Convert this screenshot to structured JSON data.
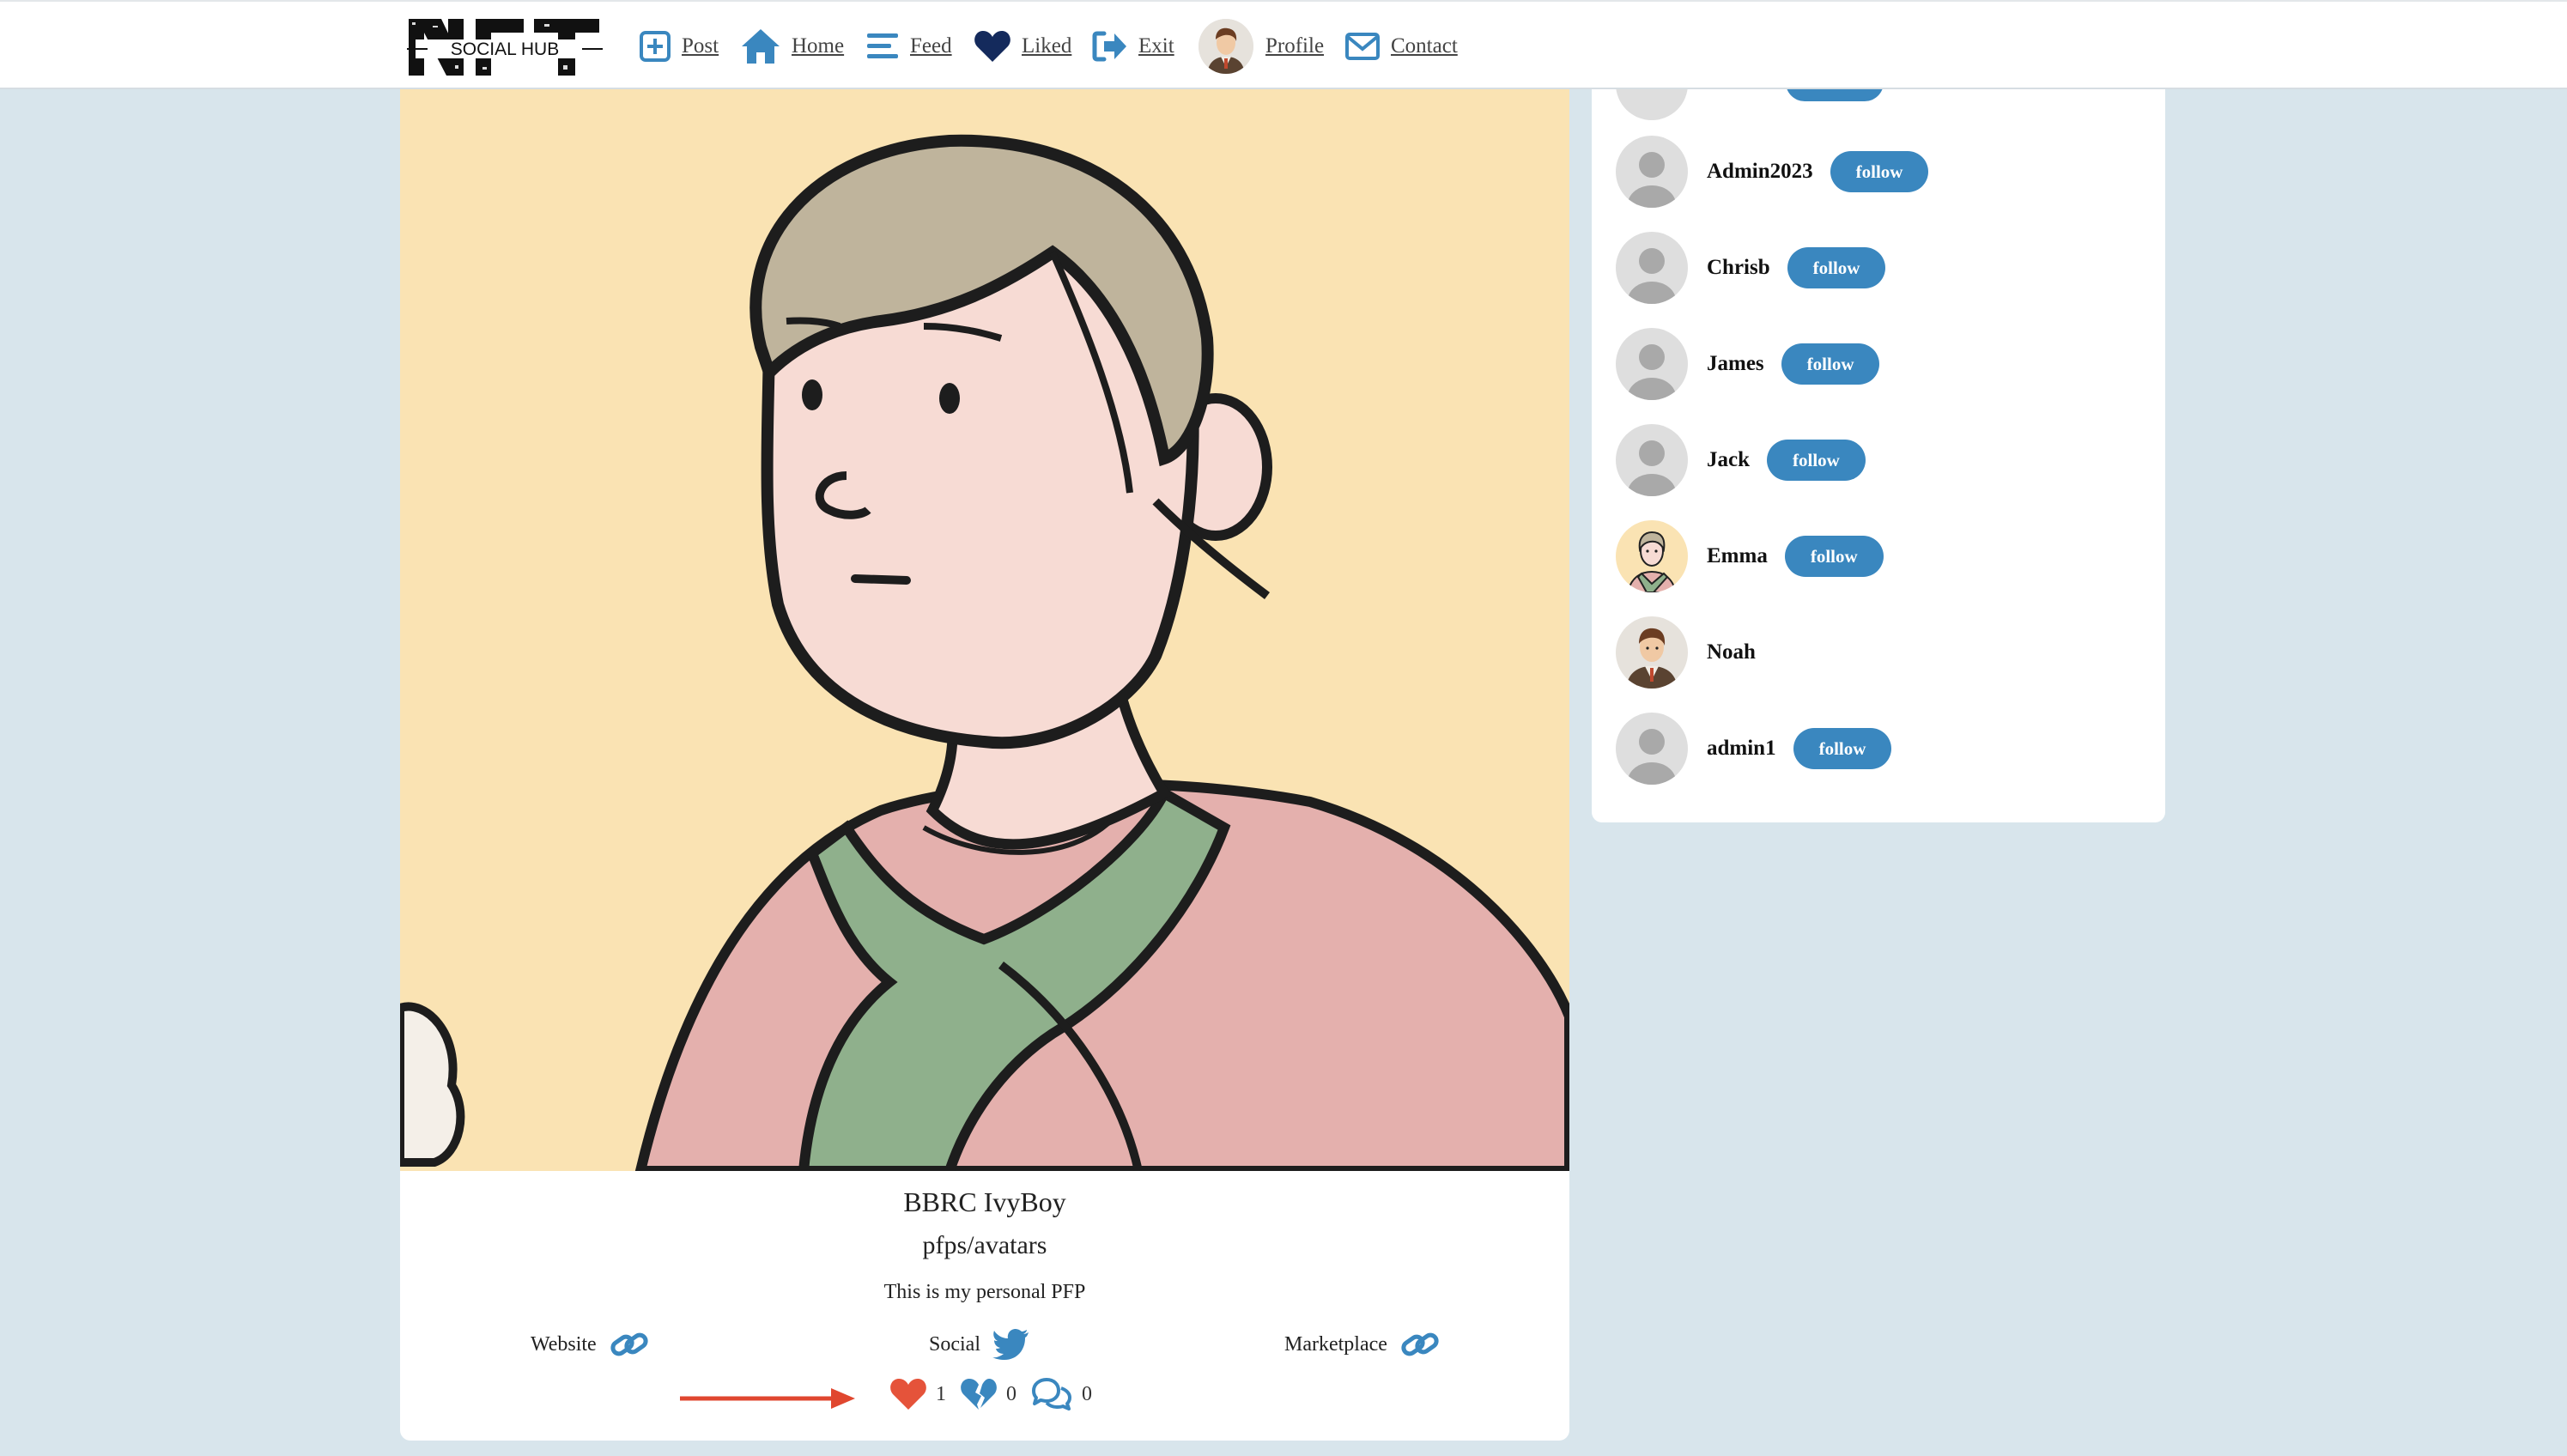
{
  "app": {
    "logo_text": "NFT",
    "logo_subtext": "SOCIAL HUB",
    "accent_color": "#3a87bf"
  },
  "nav": {
    "items": [
      {
        "label": "Post",
        "icon": "plus-square-icon"
      },
      {
        "label": "Home",
        "icon": "home-icon"
      },
      {
        "label": "Feed",
        "icon": "feed-lines-icon"
      },
      {
        "label": "Liked",
        "icon": "heart-icon"
      },
      {
        "label": "Exit",
        "icon": "sign-out-icon"
      },
      {
        "label": "Profile",
        "icon": "profile-avatar"
      },
      {
        "label": "Contact",
        "icon": "envelope-icon"
      }
    ]
  },
  "post": {
    "title": "BBRC IvyBoy",
    "category": "pfps/avatars",
    "description": "This is my personal PFP",
    "links": {
      "website": "Website",
      "social": "Social",
      "marketplace": "Marketplace"
    },
    "likes": "1",
    "dislikes": "0",
    "comments": "0"
  },
  "sidebar": {
    "follow_label": "follow",
    "users": [
      {
        "name": "Admin2023",
        "avatar": "default-avatar",
        "follow": true
      },
      {
        "name": "Chrisb",
        "avatar": "default-avatar",
        "follow": true
      },
      {
        "name": "James",
        "avatar": "default-avatar",
        "follow": true
      },
      {
        "name": "Jack",
        "avatar": "default-avatar",
        "follow": true
      },
      {
        "name": "Emma",
        "avatar": "emma-avatar",
        "follow": true
      },
      {
        "name": "Noah",
        "avatar": "noah-avatar",
        "follow": false
      },
      {
        "name": "admin1",
        "avatar": "default-avatar",
        "follow": true
      }
    ]
  }
}
